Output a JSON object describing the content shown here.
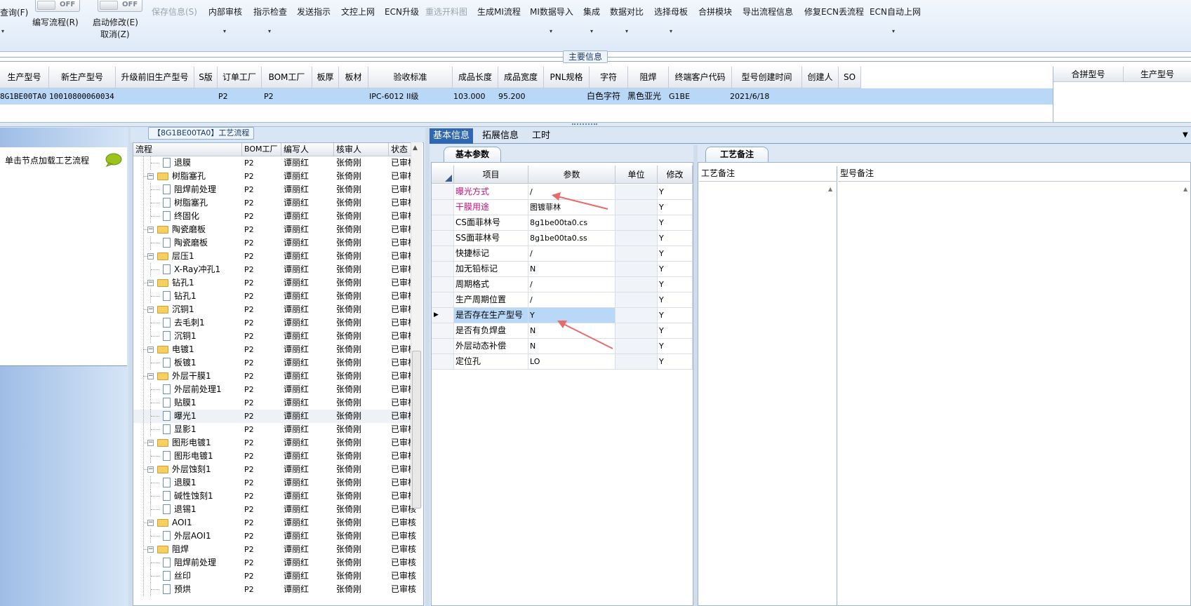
{
  "toolbar": {
    "items": [
      {
        "label": "查询(F)",
        "dropdown": true
      },
      {
        "label": "编写流程(R)"
      },
      {
        "label": "启动修改(E)"
      },
      {
        "label": "取消(Z)"
      },
      {
        "label": "保存信息(S)",
        "disabled": true
      },
      {
        "label": "内部审核",
        "dropdown": true
      },
      {
        "label": "指示检查",
        "dropdown": true
      },
      {
        "label": "发送指示"
      },
      {
        "label": "文控上网"
      },
      {
        "label": "ECN升级"
      },
      {
        "label": "重选开料图",
        "disabled": true
      },
      {
        "label": "生成MI流程"
      },
      {
        "label": "MI数据导入",
        "dropdown": true
      },
      {
        "label": "集成",
        "dropdown": true
      },
      {
        "label": "数据对比",
        "dropdown": true
      },
      {
        "label": "选择母板",
        "dropdown": true
      },
      {
        "label": "合拼模块"
      },
      {
        "label": "导出流程信息"
      },
      {
        "label": "修复ECN丢流程"
      },
      {
        "label": "ECN自动上网",
        "dropdown": true
      }
    ],
    "toggle1": "OFF",
    "toggle2": "OFF"
  },
  "main_info": {
    "title": "主要信息",
    "columns": [
      "生产型号",
      "新生产型号",
      "升级前旧生产型号",
      "S版",
      "订单工厂",
      "BOM工厂",
      "板厚",
      "板材",
      "验收标准",
      "成品长度",
      "成品宽度",
      "PNL规格",
      "字符",
      "阻焊",
      "终端客户代码",
      "型号创建时间",
      "创建人",
      "SO"
    ],
    "row": {
      "c0": "8G1BE00TA0",
      "c1": "10010800060034",
      "c4": "P2",
      "c5": "P2",
      "c8": "IPC-6012 II级",
      "c9": "103.000",
      "c10": "95.200",
      "c12": "白色字符",
      "c13": "黑色亚光",
      "c14": "G1BE",
      "c15": "2021/6/18"
    },
    "merge_columns": [
      "合拼型号",
      "生产型号"
    ]
  },
  "left_panel": {
    "hint": "单击节点加载工艺流程"
  },
  "tree": {
    "title": "【8G1BE00TA0】工艺流程",
    "columns": [
      "流程",
      "BOM工厂",
      "编写人",
      "核审人",
      "状态"
    ],
    "rows": [
      {
        "level": 2,
        "name": "退膜",
        "bom": "P2",
        "writer": "谭丽红",
        "reviewer": "张倚刚",
        "status": "已审核"
      },
      {
        "level": 1,
        "name": "树脂塞孔",
        "bom": "P2",
        "writer": "谭丽红",
        "reviewer": "张倚刚",
        "status": "已审核"
      },
      {
        "level": 2,
        "name": "阻焊前处理",
        "bom": "P2",
        "writer": "谭丽红",
        "reviewer": "张倚刚",
        "status": "已审核"
      },
      {
        "level": 2,
        "name": "树脂塞孔",
        "bom": "P2",
        "writer": "谭丽红",
        "reviewer": "张倚刚",
        "status": "已审核"
      },
      {
        "level": 2,
        "name": "终固化",
        "bom": "P2",
        "writer": "谭丽红",
        "reviewer": "张倚刚",
        "status": "已审核"
      },
      {
        "level": 1,
        "name": "陶瓷磨板",
        "bom": "P2",
        "writer": "谭丽红",
        "reviewer": "张倚刚",
        "status": "已审核"
      },
      {
        "level": 2,
        "name": "陶瓷磨板",
        "bom": "P2",
        "writer": "谭丽红",
        "reviewer": "张倚刚",
        "status": "已审核"
      },
      {
        "level": 1,
        "name": "层压1",
        "bom": "P2",
        "writer": "谭丽红",
        "reviewer": "张倚刚",
        "status": "已审核"
      },
      {
        "level": 2,
        "name": "X-Ray冲孔1",
        "bom": "P2",
        "writer": "谭丽红",
        "reviewer": "张倚刚",
        "status": "已审核"
      },
      {
        "level": 1,
        "name": "钻孔1",
        "bom": "P2",
        "writer": "谭丽红",
        "reviewer": "张倚刚",
        "status": "已审核"
      },
      {
        "level": 2,
        "name": "钻孔1",
        "bom": "P2",
        "writer": "谭丽红",
        "reviewer": "张倚刚",
        "status": "已审核"
      },
      {
        "level": 1,
        "name": "沉铜1",
        "bom": "P2",
        "writer": "谭丽红",
        "reviewer": "张倚刚",
        "status": "已审核"
      },
      {
        "level": 2,
        "name": "去毛刺1",
        "bom": "P2",
        "writer": "谭丽红",
        "reviewer": "张倚刚",
        "status": "已审核"
      },
      {
        "level": 2,
        "name": "沉铜1",
        "bom": "P2",
        "writer": "谭丽红",
        "reviewer": "张倚刚",
        "status": "已审核"
      },
      {
        "level": 1,
        "name": "电镀1",
        "bom": "P2",
        "writer": "谭丽红",
        "reviewer": "张倚刚",
        "status": "已审核"
      },
      {
        "level": 2,
        "name": "板镀1",
        "bom": "P2",
        "writer": "谭丽红",
        "reviewer": "张倚刚",
        "status": "已审核"
      },
      {
        "level": 1,
        "name": "外层干膜1",
        "bom": "P2",
        "writer": "谭丽红",
        "reviewer": "张倚刚",
        "status": "已审核"
      },
      {
        "level": 2,
        "name": "外层前处理1",
        "bom": "P2",
        "writer": "谭丽红",
        "reviewer": "张倚刚",
        "status": "已审核"
      },
      {
        "level": 2,
        "name": "贴膜1",
        "bom": "P2",
        "writer": "谭丽红",
        "reviewer": "张倚刚",
        "status": "已审核"
      },
      {
        "level": 2,
        "name": "曝光1",
        "bom": "P2",
        "writer": "谭丽红",
        "reviewer": "张倚刚",
        "status": "已审核",
        "selected": true
      },
      {
        "level": 2,
        "name": "显影1",
        "bom": "P2",
        "writer": "谭丽红",
        "reviewer": "张倚刚",
        "status": "已审核"
      },
      {
        "level": 1,
        "name": "图形电镀1",
        "bom": "P2",
        "writer": "谭丽红",
        "reviewer": "张倚刚",
        "status": "已审核"
      },
      {
        "level": 2,
        "name": "图形电镀1",
        "bom": "P2",
        "writer": "谭丽红",
        "reviewer": "张倚刚",
        "status": "已审核"
      },
      {
        "level": 1,
        "name": "外层蚀刻1",
        "bom": "P2",
        "writer": "谭丽红",
        "reviewer": "张倚刚",
        "status": "已审核"
      },
      {
        "level": 2,
        "name": "退膜1",
        "bom": "P2",
        "writer": "谭丽红",
        "reviewer": "张倚刚",
        "status": "已审核"
      },
      {
        "level": 2,
        "name": "碱性蚀刻1",
        "bom": "P2",
        "writer": "谭丽红",
        "reviewer": "张倚刚",
        "status": "已审核"
      },
      {
        "level": 2,
        "name": "退锡1",
        "bom": "P2",
        "writer": "谭丽红",
        "reviewer": "张倚刚",
        "status": "已审核"
      },
      {
        "level": 1,
        "name": "AOI1",
        "bom": "P2",
        "writer": "谭丽红",
        "reviewer": "张倚刚",
        "status": "已审核"
      },
      {
        "level": 2,
        "name": "外层AOI1",
        "bom": "P2",
        "writer": "谭丽红",
        "reviewer": "张倚刚",
        "status": "已审核"
      },
      {
        "level": 1,
        "name": "阻焊",
        "bom": "P2",
        "writer": "谭丽红",
        "reviewer": "张倚刚",
        "status": "已审核"
      },
      {
        "level": 2,
        "name": "阻焊前处理",
        "bom": "P2",
        "writer": "谭丽红",
        "reviewer": "张倚刚",
        "status": "已审核"
      },
      {
        "level": 2,
        "name": "丝印",
        "bom": "P2",
        "writer": "谭丽红",
        "reviewer": "张倚刚",
        "status": "已审核"
      },
      {
        "level": 2,
        "name": "预烘",
        "bom": "P2",
        "writer": "谭丽红",
        "reviewer": "张倚刚",
        "status": "已审核"
      }
    ]
  },
  "tabs": {
    "items": [
      "基本信息",
      "拓展信息",
      "工时"
    ],
    "active": 0
  },
  "basic_params": {
    "title": "基本参数",
    "columns": [
      "项目",
      "参数",
      "单位",
      "修改"
    ],
    "rows": [
      {
        "item": "曝光方式",
        "param": "/",
        "unit": "",
        "modify": "Y",
        "highlight": true
      },
      {
        "item": "干膜用途",
        "param": "图镀菲林",
        "unit": "",
        "modify": "Y",
        "highlight": true
      },
      {
        "item": "CS面菲林号",
        "param": "8g1be00ta0.cs",
        "unit": "",
        "modify": "Y"
      },
      {
        "item": "SS面菲林号",
        "param": "8g1be00ta0.ss",
        "unit": "",
        "modify": "Y"
      },
      {
        "item": "快捷标记",
        "param": "/",
        "unit": "",
        "modify": "Y"
      },
      {
        "item": "加无铅标记",
        "param": "N",
        "unit": "",
        "modify": "Y"
      },
      {
        "item": "周期格式",
        "param": "/",
        "unit": "",
        "modify": "Y"
      },
      {
        "item": "生产周期位置",
        "param": "/",
        "unit": "",
        "modify": "Y"
      },
      {
        "item": "是否存在生产型号",
        "param": "Y",
        "unit": "",
        "modify": "Y",
        "selected": true
      },
      {
        "item": "是否有负焊盘",
        "param": "N",
        "unit": "",
        "modify": "Y"
      },
      {
        "item": "外层动态补偿",
        "param": "N",
        "unit": "",
        "modify": "Y"
      },
      {
        "item": "定位孔",
        "param": "LO",
        "unit": "",
        "modify": "Y"
      }
    ]
  },
  "process_notes": {
    "title": "工艺备注",
    "columns": [
      "工艺备注",
      "型号备注"
    ]
  },
  "colors": {
    "accent": "#2f67b3",
    "selection": "#b9d8f7",
    "highlight_text": "#c0157a",
    "annotation_arrow": "#e86a6a"
  }
}
